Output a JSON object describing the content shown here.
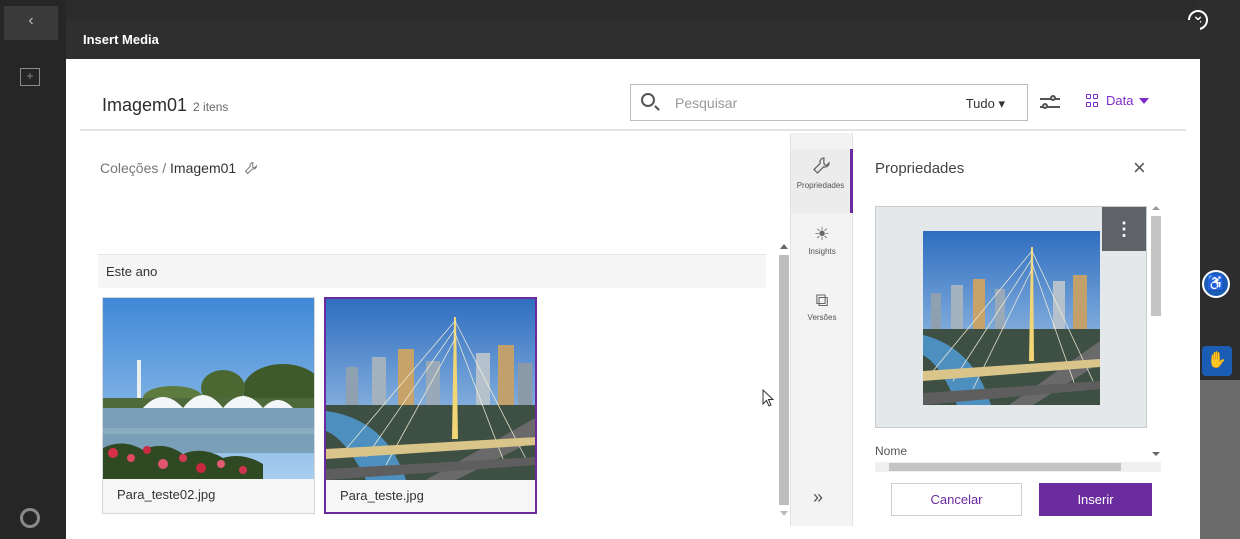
{
  "modal": {
    "title": "Insert Media"
  },
  "header": {
    "collection_title": "Imagem01",
    "item_count": "2 itens",
    "search_placeholder": "Pesquisar",
    "search_filter": "Tudo",
    "sort_label": "Data"
  },
  "breadcrumb": {
    "root": "Coleções",
    "separator": "/",
    "current": "Imagem01"
  },
  "section": {
    "label": "Este ano"
  },
  "items": [
    {
      "name": "Para_teste02.jpg",
      "selected": false
    },
    {
      "name": "Para_teste.jpg",
      "selected": true
    }
  ],
  "rail": {
    "properties": "Propriedades",
    "insights": "Insights",
    "versions": "Versões"
  },
  "props": {
    "title": "Propriedades",
    "field_name_label": "Nome",
    "cancel_label": "Cancelar",
    "insert_label": "Inserir"
  },
  "colors": {
    "accent": "#6a2c9f",
    "titlebar": "#2f2f2f",
    "a11y_blue": "#1b5db4"
  }
}
